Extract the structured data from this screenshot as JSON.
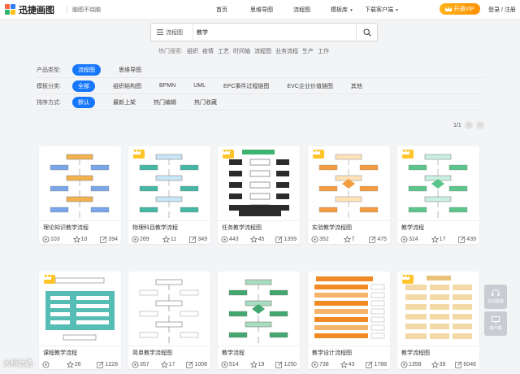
{
  "header": {
    "logo_text": "迅捷画图",
    "slogan": "脑图不烧脑",
    "nav": [
      {
        "label": "首页",
        "caret": false
      },
      {
        "label": "思维导图",
        "caret": false
      },
      {
        "label": "流程图",
        "caret": false
      },
      {
        "label": "模板库",
        "caret": true
      },
      {
        "label": "下载客户端",
        "caret": true
      }
    ],
    "vip_label": "开通VIP",
    "login_label": "登录 / 注册"
  },
  "search": {
    "category": "流程图",
    "query": "教学",
    "hot_label": "热门搜索:",
    "hot_tags": [
      "组织",
      "疫情",
      "工艺",
      "时间轴",
      "流程图",
      "业务流程",
      "生产",
      "工作"
    ]
  },
  "filters": [
    {
      "label": "产品类型:",
      "options": [
        "流程图",
        "思维导图"
      ],
      "active": 0
    },
    {
      "label": "模板分类:",
      "options": [
        "全部",
        "组织结构图",
        "BPMN",
        "UML",
        "EPC事件过程链图",
        "EVC企业价值链图",
        "其他"
      ],
      "active": 0
    },
    {
      "label": "排序方式:",
      "options": [
        "默认",
        "最新上架",
        "热门编辑",
        "热门收藏"
      ],
      "active": 0
    }
  ],
  "pager": {
    "text": "1/1",
    "prev": "‹",
    "next": "›"
  },
  "cards": [
    {
      "title": "理论知识教学流程",
      "views": "103",
      "stars": "10",
      "edits": "394",
      "vip": false,
      "style": "blue"
    },
    {
      "title": "物理科目教学流程",
      "views": "269",
      "stars": "11",
      "edits": "349",
      "vip": true,
      "style": "teal"
    },
    {
      "title": "任务教学流程图",
      "views": "443",
      "stars": "45",
      "edits": "1359",
      "vip": true,
      "style": "dark"
    },
    {
      "title": "实验教学流程图",
      "views": "352",
      "stars": "7",
      "edits": "475",
      "vip": true,
      "style": "orange"
    },
    {
      "title": "教学流程",
      "views": "324",
      "stars": "17",
      "edits": "439",
      "vip": true,
      "style": "green"
    },
    {
      "title": "课程教学流程",
      "views": "",
      "stars": "26",
      "edits": "1228",
      "vip": true,
      "style": "tealblock"
    },
    {
      "title": "简单教学流程图",
      "views": "357",
      "stars": "17",
      "edits": "1008",
      "vip": false,
      "style": "plain"
    },
    {
      "title": "教学流程",
      "views": "514",
      "stars": "19",
      "edits": "1250",
      "vip": false,
      "style": "greendiamond"
    },
    {
      "title": "教学设计流程图",
      "views": "738",
      "stars": "43",
      "edits": "1788",
      "vip": false,
      "style": "orangebars"
    },
    {
      "title": "教学流程图",
      "views": "1358",
      "stars": "39",
      "edits": "6046",
      "vip": true,
      "style": "tan"
    }
  ],
  "float": {
    "items": [
      "在线客服",
      "客户端"
    ]
  },
  "watermark": "大师之路",
  "colors": {
    "accent": "#1677ff",
    "vip": "#ff9d0a"
  }
}
